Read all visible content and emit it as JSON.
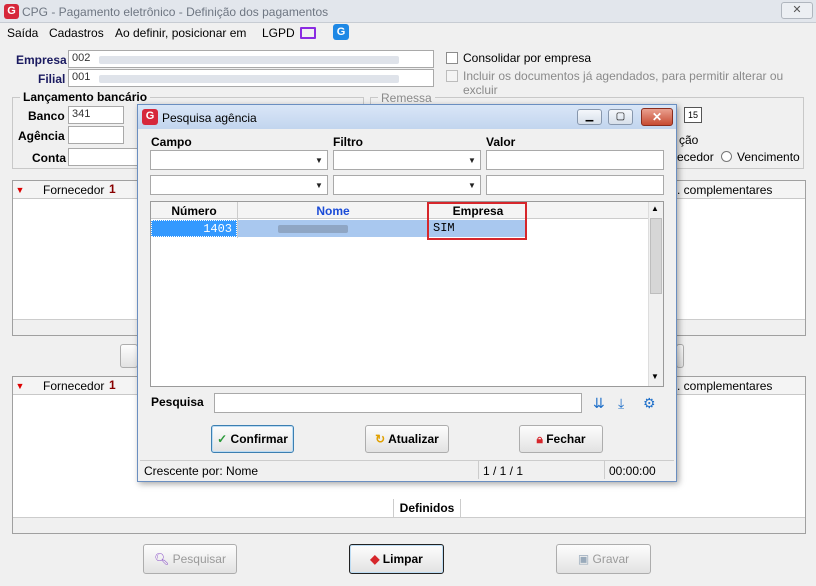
{
  "window": {
    "title": "CPG - Pagamento eletrônico - Definição dos pagamentos",
    "close": "✕"
  },
  "menu": [
    "Saída",
    "Cadastros",
    "Ao definir, posicionar em",
    "LGPD"
  ],
  "form": {
    "empresa_label": "Empresa",
    "empresa_value": "002",
    "filial_label": "Filial",
    "filial_value": "001",
    "consolidar_label": "Consolidar por empresa",
    "incluir_label": "Incluir os documentos já agendados, para permitir alterar ou excluir",
    "lancamento_label": "Lançamento bancário",
    "banco_label": "Banco",
    "banco_value": "341",
    "agencia_label": "Agência",
    "conta_label": "Conta",
    "remessa_label": "Remessa",
    "ordenacao_partial": "ção",
    "fornecedor_opt": "ecedor",
    "vencimento_opt": "Vencimento",
    "date_icon_text": "15"
  },
  "grids": {
    "top_col1": "Fornecedor",
    "top_col1_num": "1",
    "top_right_col": ". complementares",
    "bottom_col1": "Fornecedor",
    "bottom_col1_num": "1",
    "bottom_right_col": ". complementares",
    "definidos_label": "Definidos"
  },
  "bottom_buttons": {
    "pesquisar": "Pesquisar",
    "limpar": "Limpar",
    "gravar": "Gravar"
  },
  "dialog": {
    "title": "Pesquisa agência",
    "min": "▁",
    "max": "▢",
    "close": "✕",
    "campo_label": "Campo",
    "filtro_label": "Filtro",
    "valor_label": "Valor",
    "table": {
      "headers": [
        "Número",
        "Nome",
        "Empresa Comp."
      ],
      "rows": [
        {
          "numero": "1403",
          "empresa": "SIM"
        }
      ]
    },
    "pesquisa_label": "Pesquisa",
    "confirmar": "Confirmar",
    "atualizar": "Atualizar",
    "fechar": "Fechar",
    "status_sort": "Crescente por: Nome",
    "status_count": "1 / 1 / 1",
    "status_time": "00:00:00"
  },
  "colors": {
    "accent": "#1e6fc9",
    "danger": "#d6262b",
    "selection": "#3399ff",
    "brand": "#d6273b"
  }
}
